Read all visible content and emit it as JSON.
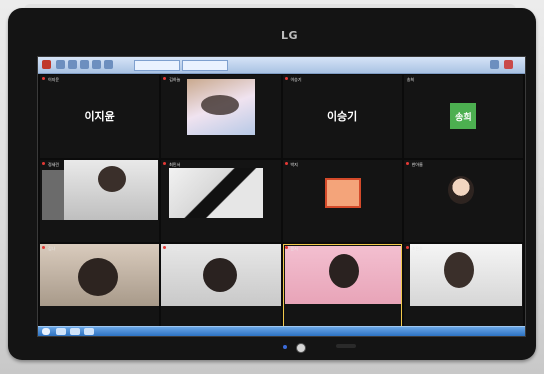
{
  "laptop": {
    "brand": "LG"
  },
  "meeting": {
    "tiles": [
      {
        "label": "이지윤",
        "name": "이지윤",
        "kind": "name",
        "mic_muted": true
      },
      {
        "label": "김하늘",
        "name": "",
        "kind": "video",
        "mic_muted": true
      },
      {
        "label": "이승기",
        "name": "이승기",
        "kind": "name",
        "mic_muted": true
      },
      {
        "label": "송희",
        "name": "",
        "kind": "avatar",
        "avatar_text": "송희",
        "avatar_color": "#4caf50",
        "mic_muted": false
      },
      {
        "label": "정세린",
        "name": "",
        "kind": "video",
        "mic_muted": true
      },
      {
        "label": "최민서",
        "name": "",
        "kind": "video",
        "mic_muted": true
      },
      {
        "label": "박지",
        "name": "",
        "kind": "video",
        "mic_muted": true
      },
      {
        "label": "한아름",
        "name": "",
        "kind": "video",
        "mic_muted": true
      },
      {
        "label": "김나",
        "name": "",
        "kind": "video",
        "mic_muted": true
      },
      {
        "label": "이도윤",
        "name": "",
        "kind": "video",
        "mic_muted": true
      },
      {
        "label": "윤서",
        "name": "",
        "kind": "video",
        "mic_muted": true
      },
      {
        "label": "조은솔",
        "name": "",
        "kind": "video",
        "mic_muted": true
      }
    ]
  },
  "colors": {
    "accent_taskbar": "#2d72c2",
    "mic_muted": "#e53935",
    "screen_bg": "#0b0b0b"
  }
}
